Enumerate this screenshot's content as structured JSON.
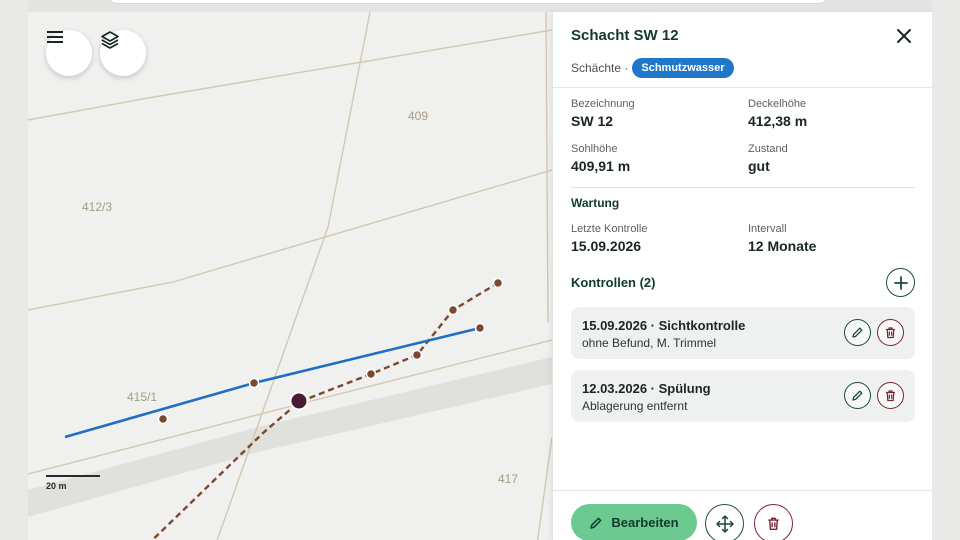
{
  "map": {
    "parcels": [
      "409",
      "412/3",
      "415/1",
      "417"
    ],
    "scale_label": "20 m",
    "menu_icon": "menu-icon",
    "layers_icon": "layers-icon"
  },
  "panel": {
    "title": "Schacht SW 12",
    "category": "Schächte ·",
    "tag": "Schmutzwasser",
    "fields": {
      "bezeichnung": {
        "label": "Bezeichnung",
        "value": "SW 12"
      },
      "deckelhoehe": {
        "label": "Deckelhöhe",
        "value": "412,38 m"
      },
      "sohlhoehe": {
        "label": "Sohlhöhe",
        "value": "409,91 m"
      },
      "zustand": {
        "label": "Zustand",
        "value": "gut"
      }
    },
    "wartung": {
      "heading": "Wartung",
      "letzte": {
        "label": "Letzte Kontrolle",
        "value": "15.09.2026"
      },
      "intervall": {
        "label": "Intervall",
        "value": "12 Monate"
      }
    },
    "kontrollen": {
      "heading": "Kontrollen (2)",
      "items": [
        {
          "title": "15.09.2026 · Sichtkontrolle",
          "subtitle": "ohne Befund, M. Trimmel"
        },
        {
          "title": "12.03.2026 · Spülung",
          "subtitle": "Ablagerung entfernt"
        }
      ]
    },
    "footer": {
      "edit_label": "Bearbeiten"
    }
  },
  "colors": {
    "accent": "#1f77c9",
    "sewer_line": "#7a4a30",
    "edit_green": "#6cc98f",
    "delete": "#7a2235",
    "selected_node": "#4a1a36"
  }
}
